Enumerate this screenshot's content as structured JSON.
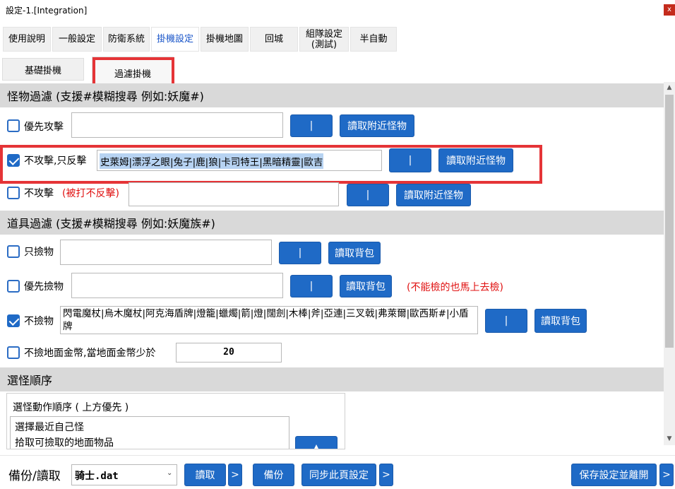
{
  "window": {
    "title": "設定-1.[Integration]",
    "close_label": "x"
  },
  "tabs": [
    {
      "label": "使用說明"
    },
    {
      "label": "一般設定"
    },
    {
      "label": "防衛系統"
    },
    {
      "label": "掛機設定"
    },
    {
      "label": "掛機地圖"
    },
    {
      "label": "回城"
    },
    {
      "label": "組隊設定\n(測試)"
    },
    {
      "label": "半自動"
    }
  ],
  "subtabs": [
    {
      "label": "基礎掛機"
    },
    {
      "label": "過濾掛機"
    }
  ],
  "monster_filter": {
    "header": "怪物過濾 (支援#模糊搜尋 例如:妖魔#)",
    "rows": [
      {
        "label": "優先攻擊",
        "checked": false,
        "value": "",
        "pipe": "|",
        "read": "讀取附近怪物",
        "note": ""
      },
      {
        "label": "不攻擊,只反擊",
        "checked": true,
        "value": "史萊姆|漂浮之眼|兔子|鹿|狼|卡司特王|黑暗精靈|歐吉",
        "pipe": "|",
        "read": "讀取附近怪物",
        "note": ""
      },
      {
        "label": "不攻擊",
        "checked": false,
        "value": "",
        "pipe": "|",
        "read": "讀取附近怪物",
        "note": "(被打不反擊)"
      }
    ]
  },
  "item_filter": {
    "header": "道具過濾 (支援#模糊搜尋 例如:妖魔族#)",
    "rows": [
      {
        "label": "只撿物",
        "checked": false,
        "value": "",
        "pipe": "|",
        "read": "讀取背包",
        "note": ""
      },
      {
        "label": "優先撿物",
        "checked": false,
        "value": "",
        "pipe": "|",
        "read": "讀取背包",
        "note": "(不能檢的也馬上去檢)"
      },
      {
        "label": "不撿物",
        "checked": true,
        "value": "閃電魔杖|烏木魔杖|阿克海盾牌|燈籠|蠟燭|箭|燈|闊劍|木棒|斧|亞連|三叉戟|弗萊爾|歐西斯#|小盾牌",
        "pipe": "|",
        "read": "讀取背包",
        "note": ""
      }
    ],
    "gold": {
      "label": "不撿地面金幣,當地面金幣少於",
      "checked": false,
      "value": "20"
    }
  },
  "target_order": {
    "header": "選怪順序",
    "group_label": "選怪動作順序 ( 上方優先 )",
    "items": [
      "選擇最近自己怪",
      "拾取可撿取的地面物品"
    ]
  },
  "bottom": {
    "backup_label": "備份/讀取",
    "file": "骑士.dat",
    "read": "讀取",
    "more": ">",
    "backup": "備份",
    "sync": "同步此頁設定",
    "save": "保存設定並離開"
  },
  "colors": {
    "accent": "#1f6ac6",
    "highlight_box": "#e53437",
    "note_red": "#e01010",
    "active_tab_text": "#1a56c9"
  }
}
